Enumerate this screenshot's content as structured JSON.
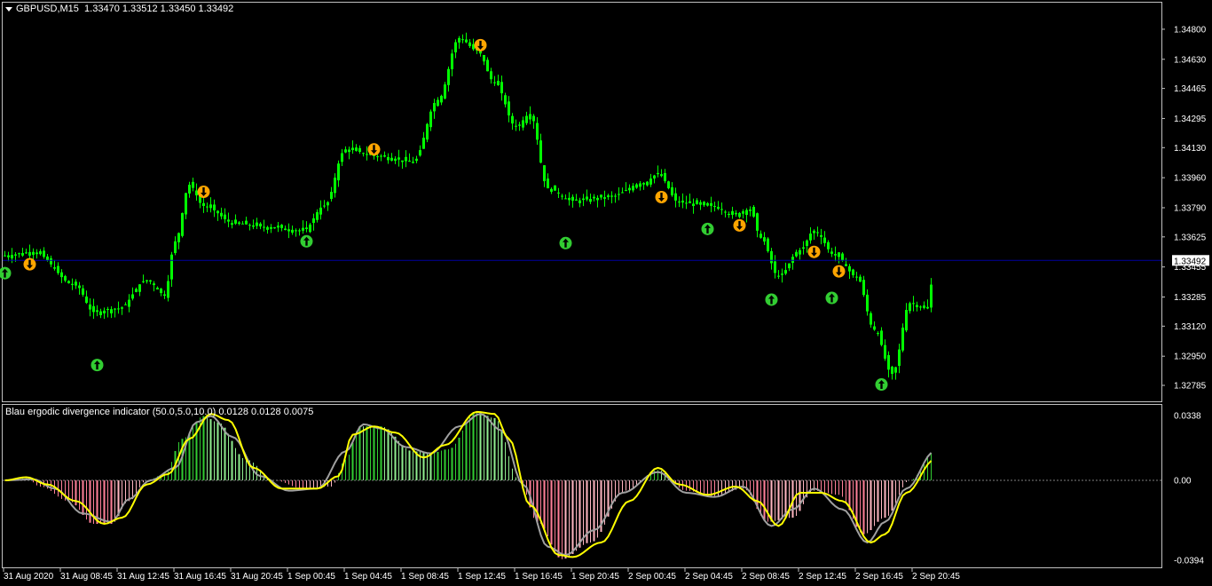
{
  "header": {
    "symbol": "GBPUSD,M15",
    "ohlc": "1.33470 1.33512 1.33450 1.33492"
  },
  "indicator": {
    "title": "Blau ergodic divergence indicator (50.0,5.0,10.0) 0.0128 0.0128 0.0075"
  },
  "colors": {
    "background": "#000000",
    "candle": "#00ff00",
    "price_line": "#0000a0",
    "up_arrow": "#32cd32",
    "down_arrow": "#ffa500",
    "hist_pos_strong": "#32cd32",
    "hist_pos_weak": "#90ee90",
    "hist_neg_strong": "#ff8099",
    "hist_neg_weak": "#ffb6c1",
    "signal_gray": "#a0a0a0",
    "signal_yellow": "#ffff00"
  },
  "chart_data": [
    {
      "type": "candlestick",
      "title": "GBPUSD,M15",
      "y_ticks": [
        "1.34800",
        "1.34630",
        "1.34465",
        "1.34295",
        "1.34130",
        "1.33960",
        "1.33790",
        "1.33625",
        "1.33455",
        "1.33285",
        "1.33120",
        "1.32950",
        "1.32785"
      ],
      "ylim": [
        1.32765,
        1.34875
      ],
      "current_price": "1.33492",
      "x_labels": [
        "31 Aug 2020",
        "31 Aug 08:45",
        "31 Aug 12:45",
        "31 Aug 16:45",
        "31 Aug 20:45",
        "1 Sep 00:45",
        "1 Sep 04:45",
        "1 Sep 08:45",
        "1 Sep 12:45",
        "1 Sep 16:45",
        "1 Sep 20:45",
        "2 Sep 00:45",
        "2 Sep 04:45",
        "2 Sep 08:45",
        "2 Sep 12:45",
        "2 Sep 16:45",
        "2 Sep 20:45"
      ],
      "bars": 262,
      "price_path": [
        [
          0,
          1.3352
        ],
        [
          8,
          1.3354
        ],
        [
          20,
          1.3335
        ],
        [
          25,
          1.332
        ],
        [
          32,
          1.3322
        ],
        [
          40,
          1.3338
        ],
        [
          45,
          1.333
        ],
        [
          48,
          1.336
        ],
        [
          52,
          1.3392
        ],
        [
          56,
          1.338
        ],
        [
          65,
          1.337
        ],
        [
          75,
          1.3368
        ],
        [
          84,
          1.3366
        ],
        [
          90,
          1.338
        ],
        [
          96,
          1.3412
        ],
        [
          106,
          1.3408
        ],
        [
          115,
          1.3405
        ],
        [
          122,
          1.344
        ],
        [
          128,
          1.3475
        ],
        [
          133,
          1.3468
        ],
        [
          138,
          1.345
        ],
        [
          144,
          1.3425
        ],
        [
          148,
          1.3432
        ],
        [
          153,
          1.339
        ],
        [
          160,
          1.3383
        ],
        [
          170,
          1.3385
        ],
        [
          180,
          1.3393
        ],
        [
          184,
          1.3398
        ],
        [
          190,
          1.3382
        ],
        [
          200,
          1.338
        ],
        [
          205,
          1.3375
        ],
        [
          210,
          1.3378
        ],
        [
          213,
          1.3362
        ],
        [
          218,
          1.334
        ],
        [
          224,
          1.3355
        ],
        [
          228,
          1.3366
        ],
        [
          234,
          1.3352
        ],
        [
          240,
          1.334
        ],
        [
          245,
          1.331
        ],
        [
          250,
          1.3285
        ],
        [
          255,
          1.3325
        ],
        [
          260,
          1.3322
        ],
        [
          262,
          1.3349
        ]
      ],
      "up_signals": [
        {
          "bar": 0,
          "price": 1.3342
        },
        {
          "bar": 26,
          "price": 1.329
        },
        {
          "bar": 85,
          "price": 1.336
        },
        {
          "bar": 158,
          "price": 1.3359
        },
        {
          "bar": 198,
          "price": 1.3367
        },
        {
          "bar": 216,
          "price": 1.3327
        },
        {
          "bar": 233,
          "price": 1.3328
        },
        {
          "bar": 247,
          "price": 1.3279
        }
      ],
      "down_signals": [
        {
          "bar": 7,
          "price": 1.3347
        },
        {
          "bar": 56,
          "price": 1.3388
        },
        {
          "bar": 104,
          "price": 1.3412
        },
        {
          "bar": 134,
          "price": 1.3471
        },
        {
          "bar": 185,
          "price": 1.3385
        },
        {
          "bar": 207,
          "price": 1.3369
        },
        {
          "bar": 228,
          "price": 1.3354
        },
        {
          "bar": 235,
          "price": 1.3343
        }
      ]
    },
    {
      "type": "histogram",
      "title": "Blau ergodic divergence indicator (50.0,5.0,10.0) 0.0128 0.0128 0.0075",
      "y_ticks": [
        "0.0338",
        "0.00",
        "-0.0394"
      ],
      "ylim": [
        -0.0394,
        0.0338
      ],
      "histogram_path": [
        [
          0,
          0.0
        ],
        [
          6,
          0.001
        ],
        [
          10,
          -0.003
        ],
        [
          18,
          -0.01
        ],
        [
          25,
          -0.021
        ],
        [
          30,
          -0.021
        ],
        [
          35,
          -0.01
        ],
        [
          40,
          0.0
        ],
        [
          45,
          0.003
        ],
        [
          50,
          0.02
        ],
        [
          56,
          0.031
        ],
        [
          60,
          0.028
        ],
        [
          68,
          0.01
        ],
        [
          76,
          0.0
        ],
        [
          84,
          -0.004
        ],
        [
          92,
          -0.003
        ],
        [
          96,
          0.01
        ],
        [
          100,
          0.026
        ],
        [
          106,
          0.026
        ],
        [
          115,
          0.014
        ],
        [
          120,
          0.013
        ],
        [
          125,
          0.015
        ],
        [
          133,
          0.033
        ],
        [
          138,
          0.03
        ],
        [
          145,
          0.0
        ],
        [
          150,
          -0.02
        ],
        [
          157,
          -0.038
        ],
        [
          165,
          -0.03
        ],
        [
          175,
          -0.005
        ],
        [
          184,
          0.005
        ],
        [
          192,
          -0.005
        ],
        [
          200,
          -0.008
        ],
        [
          208,
          -0.004
        ],
        [
          215,
          -0.02
        ],
        [
          222,
          -0.018
        ],
        [
          228,
          -0.005
        ],
        [
          235,
          -0.007
        ],
        [
          242,
          -0.026
        ],
        [
          248,
          -0.018
        ],
        [
          255,
          0.0
        ],
        [
          262,
          0.014
        ]
      ],
      "yellow_path": [
        [
          0,
          0.0
        ],
        [
          6,
          0.0015
        ],
        [
          12,
          -0.002
        ],
        [
          20,
          -0.01
        ],
        [
          28,
          -0.021
        ],
        [
          33,
          -0.018
        ],
        [
          40,
          -0.002
        ],
        [
          46,
          0.003
        ],
        [
          52,
          0.02
        ],
        [
          58,
          0.032
        ],
        [
          63,
          0.029
        ],
        [
          70,
          0.006
        ],
        [
          78,
          -0.004
        ],
        [
          88,
          -0.004
        ],
        [
          94,
          0.002
        ],
        [
          98,
          0.022
        ],
        [
          104,
          0.026
        ],
        [
          110,
          0.023
        ],
        [
          118,
          0.011
        ],
        [
          124,
          0.017
        ],
        [
          133,
          0.033
        ],
        [
          138,
          0.032
        ],
        [
          142,
          0.02
        ],
        [
          148,
          -0.012
        ],
        [
          156,
          -0.036
        ],
        [
          160,
          -0.037
        ],
        [
          168,
          -0.03
        ],
        [
          176,
          -0.01
        ],
        [
          184,
          0.006
        ],
        [
          190,
          -0.002
        ],
        [
          198,
          -0.007
        ],
        [
          206,
          -0.003
        ],
        [
          212,
          -0.01
        ],
        [
          218,
          -0.022
        ],
        [
          224,
          -0.006
        ],
        [
          230,
          -0.006
        ],
        [
          236,
          -0.01
        ],
        [
          244,
          -0.03
        ],
        [
          248,
          -0.026
        ],
        [
          254,
          -0.006
        ],
        [
          262,
          0.01
        ]
      ],
      "gray_path": [
        [
          0,
          0.0
        ],
        [
          8,
          0.0005
        ],
        [
          14,
          -0.004
        ],
        [
          22,
          -0.016
        ],
        [
          30,
          -0.02
        ],
        [
          35,
          -0.009
        ],
        [
          41,
          0.0
        ],
        [
          48,
          0.006
        ],
        [
          54,
          0.028
        ],
        [
          58,
          0.031
        ],
        [
          64,
          0.021
        ],
        [
          72,
          0.002
        ],
        [
          80,
          -0.005
        ],
        [
          88,
          -0.004
        ],
        [
          96,
          0.014
        ],
        [
          101,
          0.027
        ],
        [
          106,
          0.025
        ],
        [
          113,
          0.016
        ],
        [
          120,
          0.013
        ],
        [
          128,
          0.026
        ],
        [
          134,
          0.032
        ],
        [
          140,
          0.024
        ],
        [
          146,
          -0.002
        ],
        [
          153,
          -0.032
        ],
        [
          158,
          -0.036
        ],
        [
          166,
          -0.024
        ],
        [
          174,
          -0.006
        ],
        [
          184,
          0.004
        ],
        [
          192,
          -0.006
        ],
        [
          200,
          -0.008
        ],
        [
          208,
          -0.003
        ],
        [
          216,
          -0.022
        ],
        [
          222,
          -0.014
        ],
        [
          228,
          -0.004
        ],
        [
          236,
          -0.014
        ],
        [
          243,
          -0.03
        ],
        [
          248,
          -0.02
        ],
        [
          254,
          -0.004
        ],
        [
          262,
          0.014
        ]
      ]
    }
  ]
}
